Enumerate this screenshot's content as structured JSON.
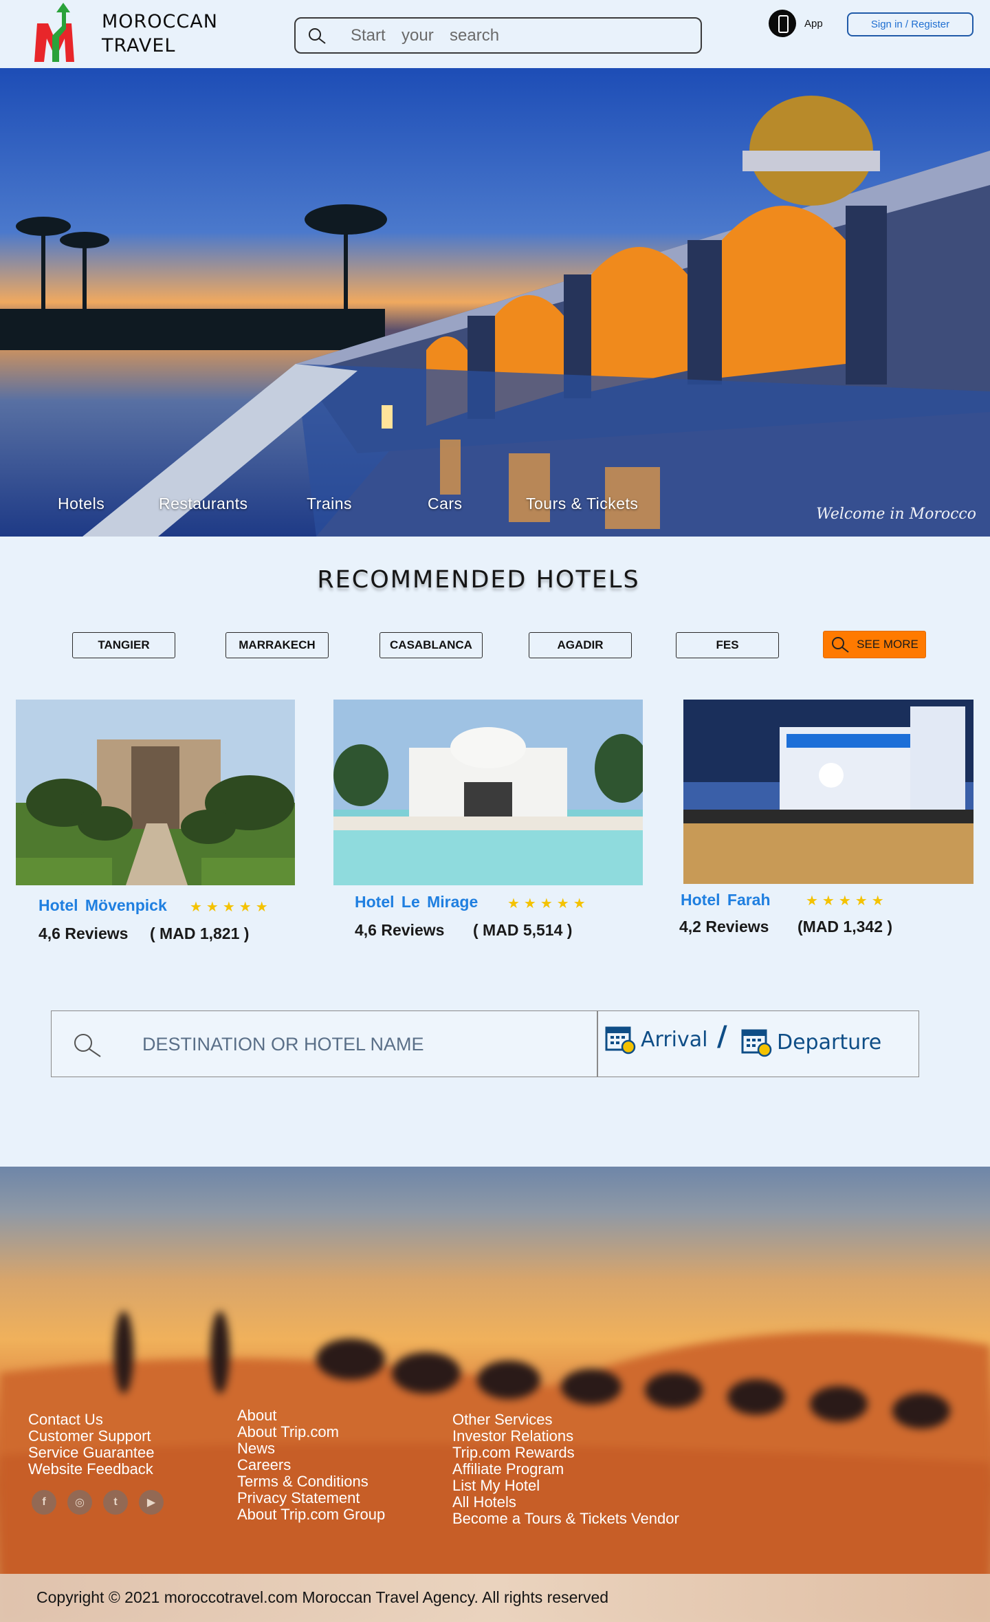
{
  "brand": {
    "line1": "MOROCCAN",
    "line2": "TRAVEL"
  },
  "search": {
    "placeholder": "Start  your  search"
  },
  "header": {
    "app_label": "App",
    "signin_label": "Sign in / Register"
  },
  "hero": {
    "nav": [
      "Hotels",
      "Restaurants",
      "Trains",
      "Cars",
      "Tours & Tickets"
    ],
    "tagline": "Welcome in Morocco"
  },
  "recommended": {
    "title": "RECOMMENDED HOTELS",
    "cities": [
      "TANGIER",
      "MARRAKECH",
      "CASABLANCA",
      "AGADIR",
      "FES"
    ],
    "see_more": "SEE MORE",
    "hotels": [
      {
        "name": "Hotel  Mövenpick",
        "stars": "★★★★★",
        "reviews": "4,6 Reviews",
        "price": "( MAD 1,821 )"
      },
      {
        "name": "Hotel  Le  Mirage",
        "stars": "★★★★★",
        "reviews": "4,6 Reviews",
        "price": "( MAD 5,514 )"
      },
      {
        "name": "Hotel  Farah",
        "stars": "★★★★★",
        "reviews": "4,2 Reviews",
        "price": "(MAD 1,342 )"
      }
    ]
  },
  "booking": {
    "destination_placeholder": "DESTINATION OR HOTEL NAME",
    "arrival": "Arrival",
    "separator": "/",
    "departure": "Departure"
  },
  "footer": {
    "col1": [
      "Contact Us",
      "Customer Support",
      "Service Guarantee",
      "Website Feedback"
    ],
    "col2": [
      "About",
      "About Trip.com",
      "News",
      "Careers",
      "Terms & Conditions",
      "Privacy Statement",
      "About Trip.com Group"
    ],
    "col3": [
      "Other Services",
      "Investor Relations",
      "Trip.com Rewards",
      "Affiliate Program",
      "List My Hotel",
      "All Hotels",
      "Become a Tours & Tickets Vendor"
    ],
    "social": [
      "f",
      "◎",
      "t",
      "▶"
    ],
    "copyright": "Copyright © 2021 moroccotravel.com Moroccan Travel Agency. All rights reserved"
  },
  "colors": {
    "accent": "#ff7a00",
    "link_blue": "#1f7fe0",
    "date_blue": "#0e4d86",
    "star": "#f4c200"
  }
}
